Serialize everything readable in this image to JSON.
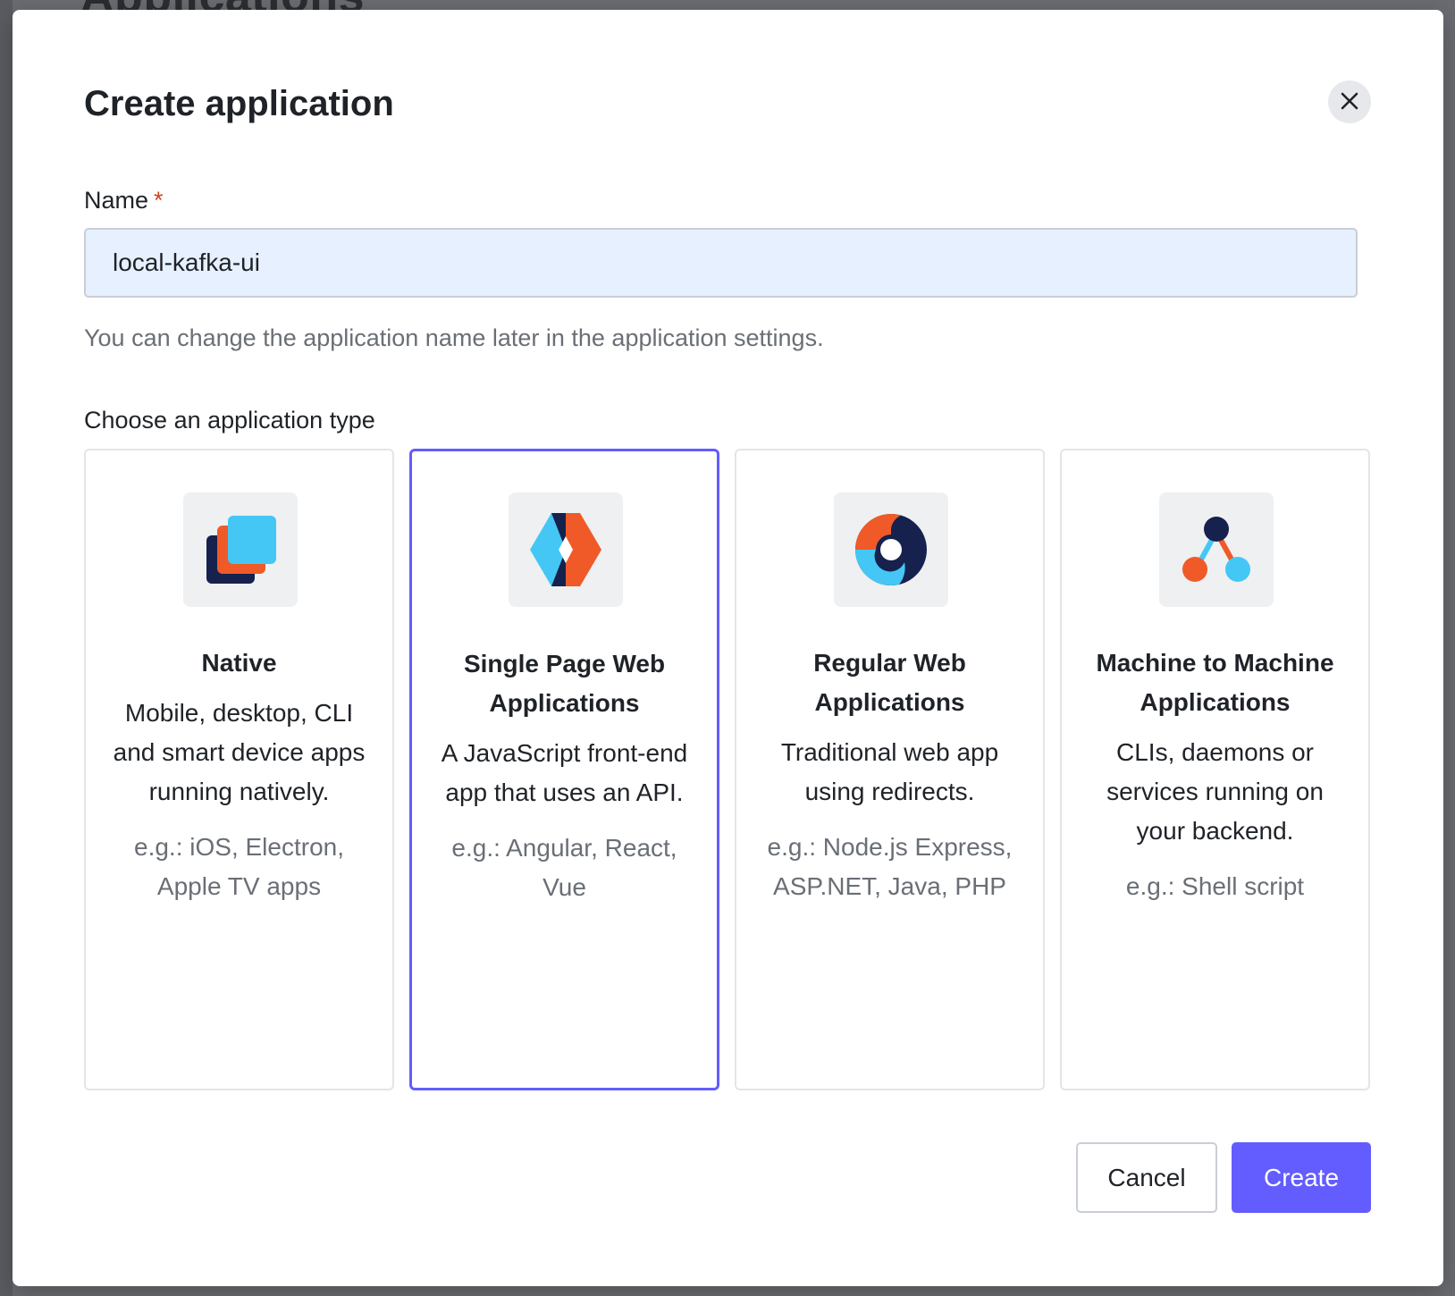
{
  "background": {
    "page_title": "Applications"
  },
  "modal": {
    "title": "Create application",
    "close_icon": "close-icon"
  },
  "name_field": {
    "label": "Name",
    "required_marker": "*",
    "value": "local-kafka-ui",
    "helper": "You can change the application name later in the application settings."
  },
  "app_type": {
    "label": "Choose an application type",
    "selected": "Single Page Web Applications",
    "options": [
      {
        "icon": "native-app-icon",
        "title": "Native",
        "description": "Mobile, desktop, CLI and smart device apps running natively.",
        "example": "e.g.: iOS, Electron, Apple TV apps"
      },
      {
        "icon": "spa-icon",
        "title": "Single Page Web Applications",
        "description": "A JavaScript front-end app that uses an API.",
        "example": "e.g.: Angular, React, Vue"
      },
      {
        "icon": "regular-web-app-icon",
        "title": "Regular Web Applications",
        "description": "Traditional web app using redirects.",
        "example": "e.g.: Node.js Express, ASP.NET, Java, PHP"
      },
      {
        "icon": "machine-to-machine-icon",
        "title": "Machine to Machine Applications",
        "description": "CLIs, daemons or services running on your backend.",
        "example": "e.g.: Shell script"
      }
    ]
  },
  "footer": {
    "cancel_label": "Cancel",
    "create_label": "Create"
  },
  "colors": {
    "accent": "#635dff",
    "orange": "#f05a28",
    "cyan": "#44c7f4",
    "navy": "#16214d",
    "required": "#d2421f"
  }
}
